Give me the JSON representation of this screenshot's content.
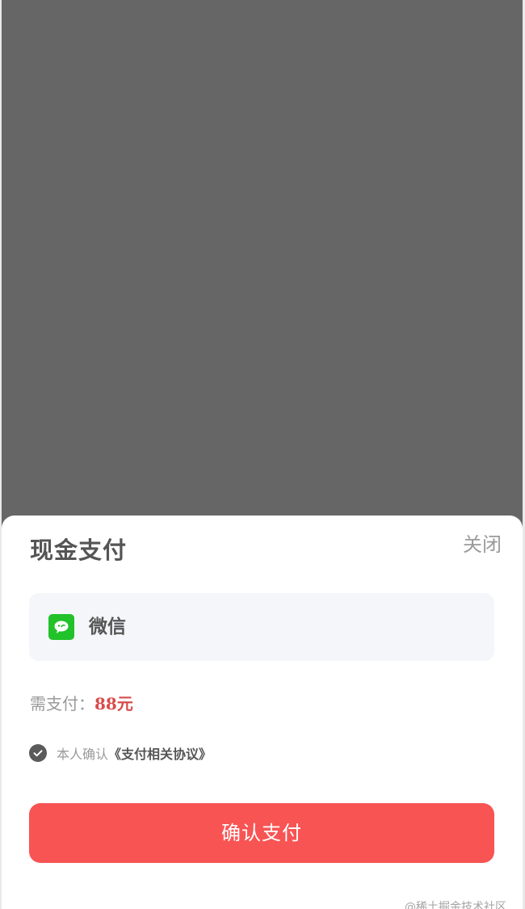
{
  "sheet": {
    "title": "现金支付",
    "close_label": "关闭"
  },
  "payment_method": {
    "icon": "wechat-icon",
    "label": "微信"
  },
  "amount": {
    "label": "需支付：",
    "value": "88元"
  },
  "agreement": {
    "checked": true,
    "prefix": "本人确认",
    "link_text": "《支付相关协议》"
  },
  "confirm_button": {
    "label": "确认支付"
  },
  "watermark": {
    "text": "@稀土掘金技术社区"
  },
  "colors": {
    "overlay": "#666666",
    "accent": "#f85454",
    "price": "#d94b4b",
    "wechat": "#22c22a"
  }
}
